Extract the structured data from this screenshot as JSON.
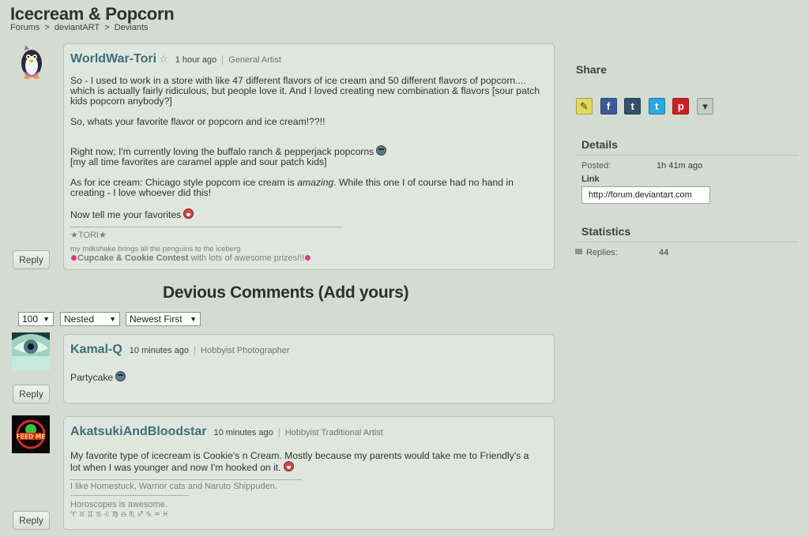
{
  "page": {
    "title": "Icecream & Popcorn",
    "breadcrumb": [
      "Forums",
      ">",
      "deviantART",
      ">",
      "Deviants"
    ]
  },
  "post": {
    "username": "WorldWar-Tori",
    "star": "☆",
    "time": "1 hour ago",
    "rank": "General Artist",
    "p1": "So - I used to work in a store with like 47 different flavors of ice cream and 50 different flavors of popcorn.... which is actually fairly ridiculous, but people love it. And I loved creating new combination & flavors [sour patch kids popcorn anybody?]",
    "p2": "So, whats your favorite flavor or popcorn and ice cream!??!!",
    "p3a": "Right now; I'm currently loving the buffalo ranch & pepperjack popcorns",
    "p3b": "[my all time favorites are caramel apple and sour patch kids]",
    "p4a": "As for ice cream: Chicago style popcorn ice cream is",
    "p4em": "amazing",
    "p4b": ". While this one I of course had no hand in creating - I love whoever did this!",
    "p5": "Now tell me your favorites",
    "sig1": "★TORI★",
    "sig2": "my milkshake brings all the penguins to the iceberg",
    "sig3_bold": "Cupcake & Cookie Contest",
    "sig3_rest": " with lots of awesome prizes!!!",
    "reply_label": "Reply"
  },
  "comments_section": {
    "title": "Devious Comments (Add yours)",
    "selects": [
      "100",
      "Nested",
      "Newest First"
    ]
  },
  "comments": [
    {
      "username": "Kamal-Q",
      "time": "10 minutes ago",
      "rank": "Hobbyist Photographer",
      "text": "Partycake",
      "reply_label": "Reply"
    },
    {
      "username": "AkatsukiAndBloodstar",
      "time": "10 minutes ago",
      "rank": "Hobbyist Traditional Artist",
      "text": "My favorite type of icecream is Cookie's n Cream. Mostly because my parents would take me to Friendly's a lot when I was younger and now I'm hooked on it.",
      "sig1": "I like Homestuck, Warrior cats and Naruto Shippuden.",
      "sig2": "--------------------------------------------------",
      "sig3": "Horoscopes is awesome.",
      "sig4": "♈ ♉ ♊ ♋ ♌ ♍ ♎ ♏ ♐ ♑ ♒ ♓",
      "reply_label": "Reply"
    }
  ],
  "sidebar": {
    "share_title": "Share",
    "share_icons": [
      {
        "name": "note-icon",
        "glyph": "✎",
        "color": "#e4d860"
      },
      {
        "name": "facebook-icon",
        "glyph": "f",
        "color": "#3b5b98"
      },
      {
        "name": "tumblr-icon",
        "glyph": "t",
        "color": "#34506b"
      },
      {
        "name": "twitter-icon",
        "glyph": "t",
        "color": "#2aa8e0"
      },
      {
        "name": "pinterest-icon",
        "glyph": "p",
        "color": "#cb2027"
      },
      {
        "name": "more-icon",
        "glyph": "▾",
        "color": "#c5cdc4"
      }
    ],
    "details_title": "Details",
    "posted_label": "Posted:",
    "posted_value": "1h 41m ago",
    "link_label": "Link",
    "link_value": "http://forum.deviantart.com",
    "statistics_title": "Statistics",
    "replies_label": "Replies:",
    "replies_value": "44"
  },
  "colors": {
    "background": "#d4dcd2",
    "username": "#3f6f7a",
    "box": "#dfe6de"
  }
}
